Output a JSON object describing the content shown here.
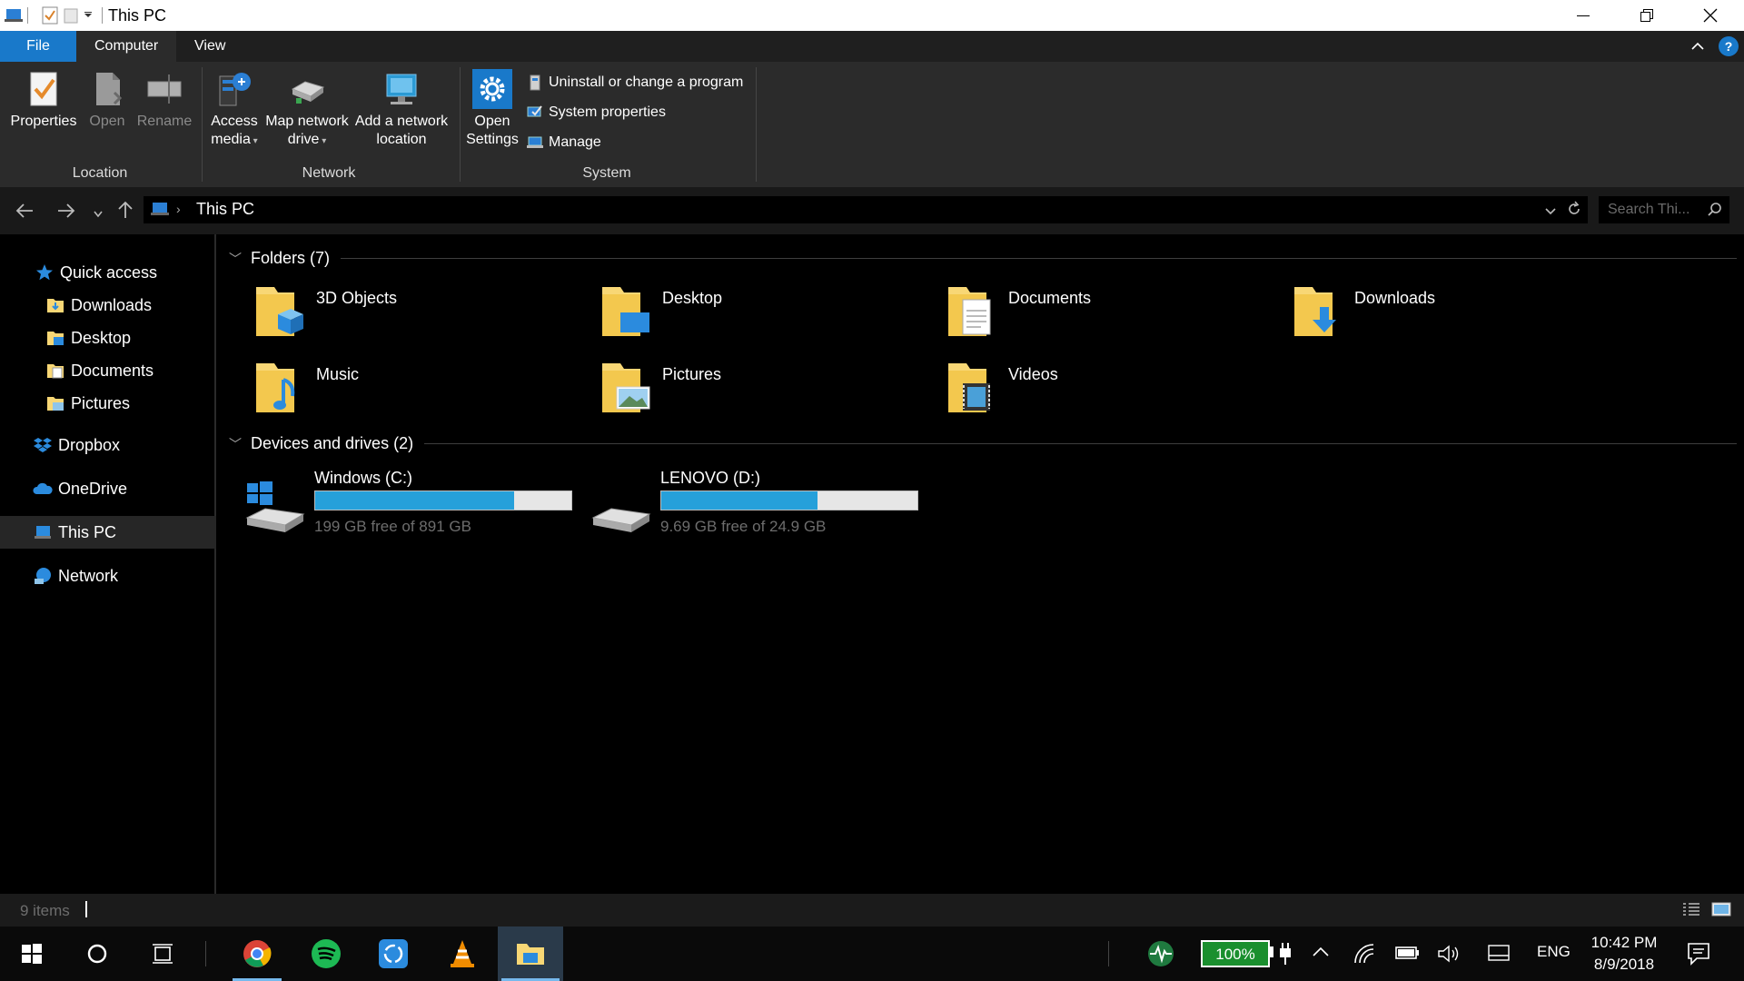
{
  "window": {
    "title": "This PC"
  },
  "ribbon": {
    "tabs": [
      {
        "label": "File"
      },
      {
        "label": "Computer"
      },
      {
        "label": "View"
      }
    ],
    "location": {
      "label": "Location",
      "properties": "Properties",
      "open": "Open",
      "rename": "Rename"
    },
    "network": {
      "label": "Network",
      "access_media_1": "Access",
      "access_media_2": "media",
      "map_drive_1": "Map network",
      "map_drive_2": "drive",
      "add_location_1": "Add a network",
      "add_location_2": "location"
    },
    "system": {
      "label": "System",
      "open_settings_1": "Open",
      "open_settings_2": "Settings",
      "uninstall": "Uninstall or change a program",
      "system_properties": "System properties",
      "manage": "Manage"
    }
  },
  "address": {
    "crumb": "This PC",
    "search_placeholder": "Search Thi..."
  },
  "nav": {
    "quick_access": "Quick access",
    "pinned": [
      {
        "label": "Downloads"
      },
      {
        "label": "Desktop"
      },
      {
        "label": "Documents"
      },
      {
        "label": "Pictures"
      }
    ],
    "dropbox": "Dropbox",
    "onedrive": "OneDrive",
    "this_pc": "This PC",
    "network": "Network"
  },
  "folders": {
    "header": "Folders (7)",
    "items": [
      {
        "label": "3D Objects"
      },
      {
        "label": "Desktop"
      },
      {
        "label": "Documents"
      },
      {
        "label": "Downloads"
      },
      {
        "label": "Music"
      },
      {
        "label": "Pictures"
      },
      {
        "label": "Videos"
      }
    ]
  },
  "drives": {
    "header": "Devices and drives (2)",
    "items": [
      {
        "label": "Windows (C:)",
        "free": "199 GB free of 891 GB",
        "used_fraction": 0.777
      },
      {
        "label": "LENOVO (D:)",
        "free": "9.69 GB free of 24.9 GB",
        "used_fraction": 0.611
      }
    ]
  },
  "status": {
    "count": "9 items"
  },
  "tray": {
    "battery": "100%",
    "lang": "ENG",
    "time": "10:42 PM",
    "date": "8/9/2018"
  },
  "colors": {
    "accent": "#1979ca",
    "drive_fill": "#26a0da",
    "folder_yellow": "#f8d775"
  }
}
